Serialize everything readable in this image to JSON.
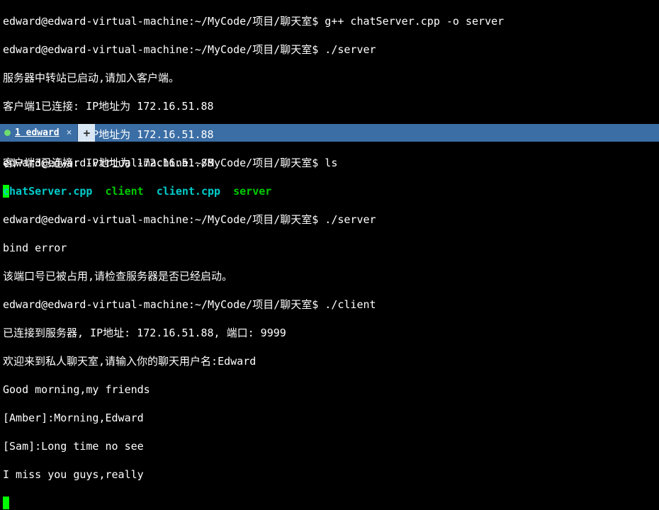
{
  "top_pane": {
    "prompt": "edward@edward-virtual-machine:~/MyCode/项目/聊天室$",
    "line1_cmd": "g++ chatServer.cpp -o server",
    "line2_cmd": "./server",
    "output": {
      "start_msg": "服务器中转站已启动,请加入客户端。",
      "client1": "客户端1已连接: IP地址为 172.16.51.88",
      "client2": "客户端2已连接: IP地址为 172.16.51.88",
      "client3": "客户端3已连接: IP地址为 172.16.51.88"
    }
  },
  "tab": {
    "title": "1 edward",
    "close": "×",
    "add": "+"
  },
  "bottom_pane": {
    "prompt": "edward@edward-virtual-machine:~/MyCode/项目/聊天室$",
    "ls_cmd": "ls",
    "ls_output": {
      "file1": "chatServer.cpp",
      "file2": "client",
      "file3": "client.cpp",
      "file4": "server"
    },
    "server_cmd": "./server",
    "bind_error": "bind error",
    "bind_msg": "该端口号已被占用,请检查服务器是否已经启动。",
    "client_cmd": "./client",
    "connected_msg": "已连接到服务器, IP地址: 172.16.51.88, 端口: 9999",
    "welcome_prefix": "欢迎来到私人聊天室,请输入你的聊天用户名:",
    "welcome_name": "Edward",
    "chat1": "Good morning,my friends",
    "chat2": "[Amber]:Morning,Edward",
    "chat3": "[Sam]:Long time no see",
    "chat4": "I miss you guys,really"
  }
}
